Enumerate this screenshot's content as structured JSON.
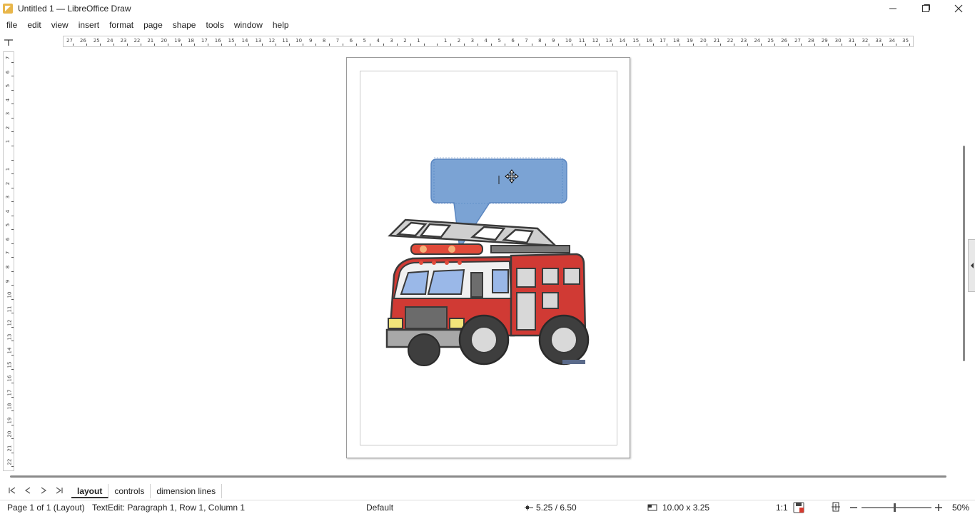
{
  "window": {
    "title": "Untitled 1 — LibreOffice Draw"
  },
  "menu": [
    "file",
    "edit",
    "view",
    "insert",
    "format",
    "page",
    "shape",
    "tools",
    "window",
    "help"
  ],
  "ruler": {
    "h_labels": [
      "27",
      "26",
      "25",
      "24",
      "23",
      "22",
      "21",
      "20",
      "19",
      "18",
      "17",
      "16",
      "15",
      "14",
      "13",
      "12",
      "11",
      "10",
      "9",
      "8",
      "7",
      "6",
      "5",
      "4",
      "3",
      "2",
      "1",
      "",
      "1",
      "2",
      "3",
      "4",
      "5",
      "6",
      "7",
      "8",
      "9",
      "10",
      "11",
      "12",
      "13",
      "14",
      "15",
      "16",
      "17",
      "18",
      "19",
      "20",
      "21",
      "22",
      "23",
      "24",
      "25",
      "26",
      "27",
      "28",
      "29",
      "30",
      "31",
      "32",
      "33",
      "34",
      "35"
    ],
    "v_labels": [
      "7",
      "6",
      "5",
      "4",
      "3",
      "2",
      "1",
      "",
      "1",
      "2",
      "3",
      "4",
      "5",
      "6",
      "7",
      "8",
      "9",
      "10",
      "11",
      "12",
      "13",
      "14",
      "15",
      "16",
      "17",
      "18",
      "19",
      "20",
      "21",
      "22"
    ]
  },
  "tabs": {
    "items": [
      "layout",
      "controls",
      "dimension lines"
    ],
    "active": "layout"
  },
  "status": {
    "page": "Page 1 of 1 (Layout)",
    "edit": "TextEdit: Paragraph 1, Row 1, Column 1",
    "master": "Default",
    "position": "5.25 / 6.50",
    "size": "10.00 x 3.25",
    "scale": "1:1",
    "zoom": "50%"
  },
  "colors": {
    "callout_fill": "#7ba3d4",
    "callout_stroke": "#5b86c0",
    "truck_red": "#d03a34",
    "truck_gray": "#7d7d7d"
  },
  "icons": [
    "app-icon",
    "minimize-icon",
    "maximize-icon",
    "close-icon",
    "first-page-icon",
    "prev-page-icon",
    "next-page-icon",
    "last-page-icon",
    "position-icon",
    "size-icon",
    "save-indicator-icon",
    "fit-page-icon",
    "zoom-out-icon",
    "zoom-in-icon",
    "move-cursor-icon"
  ]
}
